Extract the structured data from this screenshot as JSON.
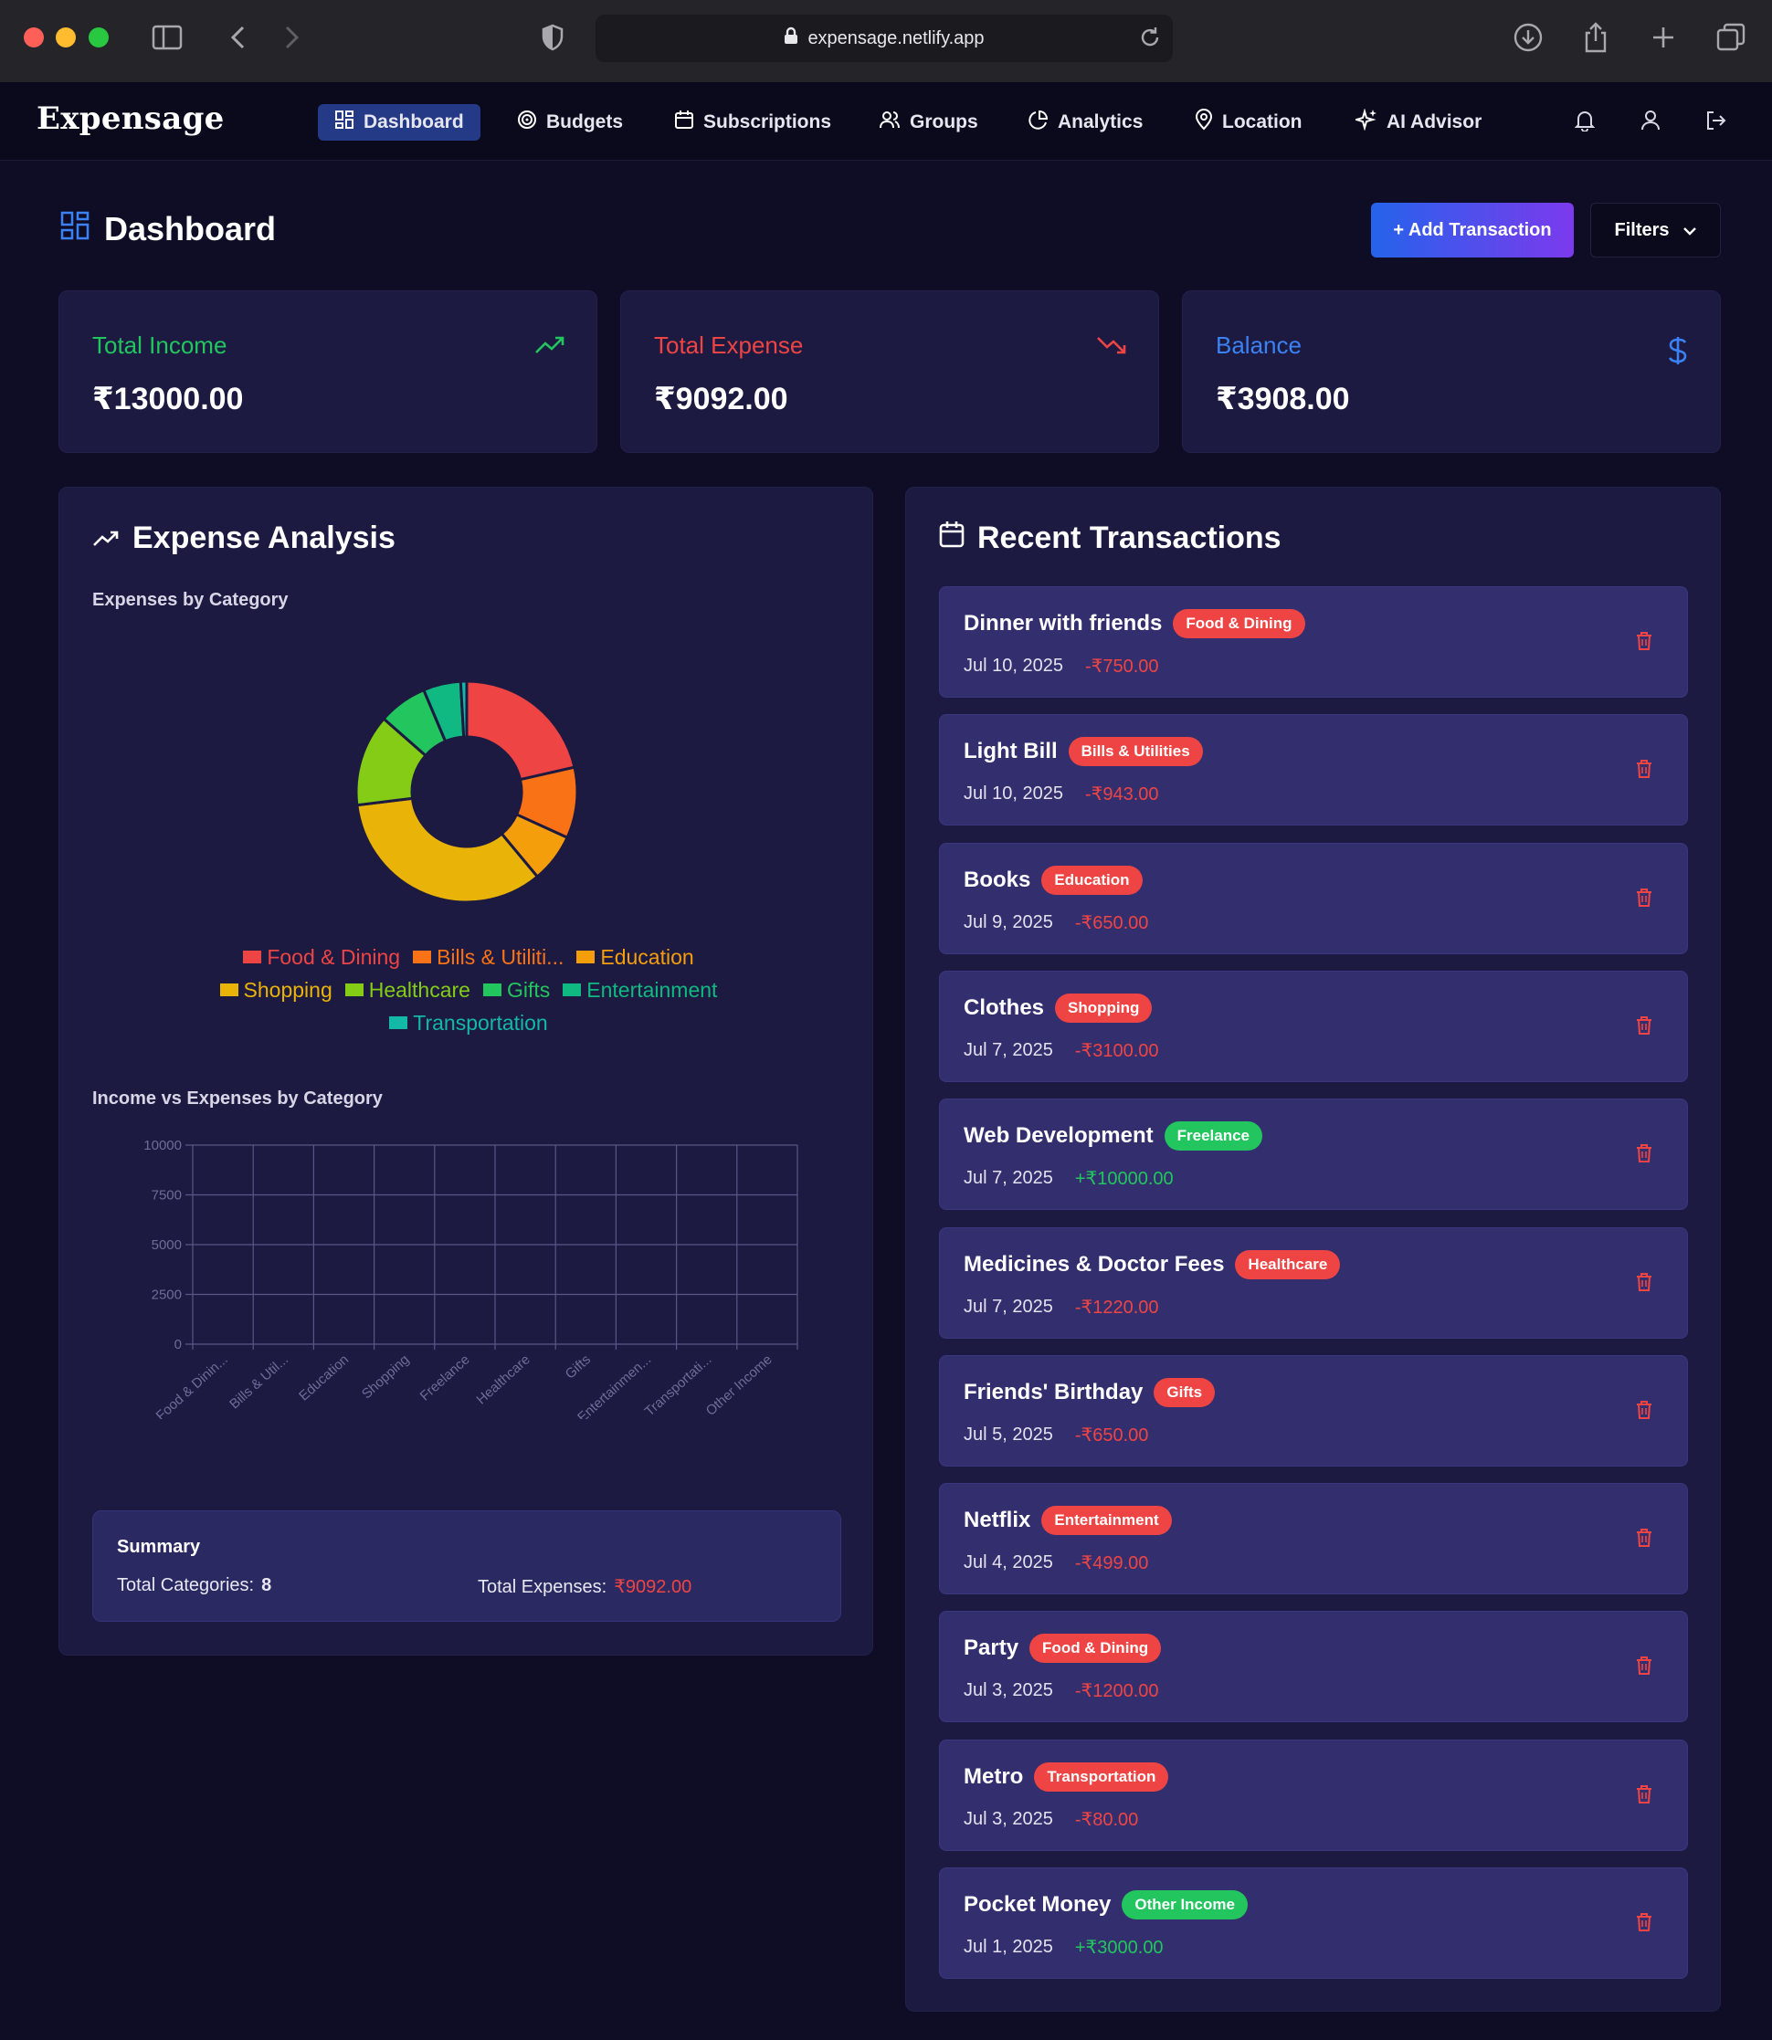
{
  "browser": {
    "url": "expensage.netlify.app"
  },
  "app": {
    "brand": "Expensage",
    "nav": [
      {
        "label": "Dashboard",
        "icon": "dashboard-icon",
        "active": true
      },
      {
        "label": "Budgets",
        "icon": "target-icon"
      },
      {
        "label": "Subscriptions",
        "icon": "calendar-icon"
      },
      {
        "label": "Groups",
        "icon": "users-icon"
      },
      {
        "label": "Analytics",
        "icon": "pie-chart-icon"
      },
      {
        "label": "Location",
        "icon": "map-pin-icon"
      },
      {
        "label": "AI Advisor",
        "icon": "sparkles-icon"
      }
    ]
  },
  "header": {
    "title": "Dashboard",
    "add_label": "+ Add Transaction",
    "filters_label": "Filters"
  },
  "stats": {
    "income": {
      "label": "Total Income",
      "value": "₹13000.00"
    },
    "expense": {
      "label": "Total Expense",
      "value": "₹9092.00"
    },
    "balance": {
      "label": "Balance",
      "value": "₹3908.00"
    }
  },
  "colors": {
    "income": "#22c55e",
    "expense": "#ef4444",
    "balance": "#3b82f6",
    "panel": "#1c1a41",
    "card": "#332f6e"
  },
  "analysis": {
    "title": "Expense Analysis",
    "pie_subtitle": "Expenses by Category",
    "bar_subtitle": "Income vs Expenses by Category",
    "summary": {
      "title": "Summary",
      "categories_label": "Total Categories:",
      "categories_value": "8",
      "expenses_label": "Total Expenses:",
      "expenses_value": "₹9092.00"
    }
  },
  "chart_data": [
    {
      "type": "pie",
      "title": "Expenses by Category",
      "categories": [
        "Food & Dining",
        "Bills & Utiliti...",
        "Education",
        "Shopping",
        "Healthcare",
        "Gifts",
        "Entertainment",
        "Transportation"
      ],
      "values": [
        1950,
        943,
        650,
        3100,
        1220,
        650,
        499,
        80
      ],
      "colors": [
        "#ef4444",
        "#f97316",
        "#f59e0b",
        "#eab308",
        "#84cc16",
        "#22c55e",
        "#10b981",
        "#14b8a6"
      ],
      "legend_position": "bottom"
    },
    {
      "type": "bar",
      "title": "Income vs Expenses by Category",
      "categories": [
        "Food & Dinin...",
        "Bills & Util...",
        "Education",
        "Shopping",
        "Freelance",
        "Healthcare",
        "Gifts",
        "Entertainmen...",
        "Transportati...",
        "Other Income"
      ],
      "y_ticks": [
        "0",
        "2500",
        "5000",
        "7500",
        "10000"
      ],
      "ylim": [
        0,
        10000
      ],
      "grid": true
    }
  ],
  "transactions": {
    "title": "Recent Transactions",
    "items": [
      {
        "name": "Dinner with friends",
        "category": "Food & Dining",
        "date": "Jul 10, 2025",
        "amount": "-₹750.00",
        "type": "expense"
      },
      {
        "name": "Light Bill",
        "category": "Bills & Utilities",
        "date": "Jul 10, 2025",
        "amount": "-₹943.00",
        "type": "expense"
      },
      {
        "name": "Books",
        "category": "Education",
        "date": "Jul 9, 2025",
        "amount": "-₹650.00",
        "type": "expense"
      },
      {
        "name": "Clothes",
        "category": "Shopping",
        "date": "Jul 7, 2025",
        "amount": "-₹3100.00",
        "type": "expense"
      },
      {
        "name": "Web Development",
        "category": "Freelance",
        "date": "Jul 7, 2025",
        "amount": "+₹10000.00",
        "type": "income"
      },
      {
        "name": "Medicines & Doctor Fees",
        "category": "Healthcare",
        "date": "Jul 7, 2025",
        "amount": "-₹1220.00",
        "type": "expense"
      },
      {
        "name": "Friends' Birthday",
        "category": "Gifts",
        "date": "Jul 5, 2025",
        "amount": "-₹650.00",
        "type": "expense"
      },
      {
        "name": "Netflix",
        "category": "Entertainment",
        "date": "Jul 4, 2025",
        "amount": "-₹499.00",
        "type": "expense"
      },
      {
        "name": "Party",
        "category": "Food & Dining",
        "date": "Jul 3, 2025",
        "amount": "-₹1200.00",
        "type": "expense"
      },
      {
        "name": "Metro",
        "category": "Transportation",
        "date": "Jul 3, 2025",
        "amount": "-₹80.00",
        "type": "expense"
      },
      {
        "name": "Pocket Money",
        "category": "Other Income",
        "date": "Jul 1, 2025",
        "amount": "+₹3000.00",
        "type": "income"
      }
    ]
  }
}
